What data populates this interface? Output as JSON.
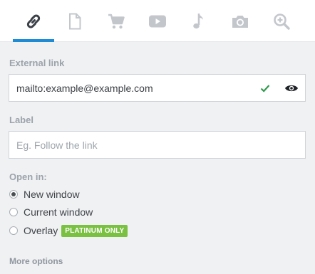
{
  "tabs": [
    {
      "icon": "link-icon",
      "active": true
    },
    {
      "icon": "document-icon",
      "active": false
    },
    {
      "icon": "cart-icon",
      "active": false
    },
    {
      "icon": "youtube-icon",
      "active": false
    },
    {
      "icon": "music-note-icon",
      "active": false
    },
    {
      "icon": "camera-icon",
      "active": false
    },
    {
      "icon": "zoom-in-icon",
      "active": false
    }
  ],
  "external_link": {
    "label": "External link",
    "value": "mailto:example@example.com",
    "valid": true
  },
  "label_field": {
    "label": "Label",
    "placeholder": "Eg. Follow the link",
    "value": ""
  },
  "open_in": {
    "label": "Open in:",
    "selected": "new_window",
    "options": [
      {
        "id": "new_window",
        "label": "New window"
      },
      {
        "id": "current_window",
        "label": "Current window"
      },
      {
        "id": "overlay",
        "label": "Overlay",
        "badge": "PLATINUM ONLY"
      }
    ]
  },
  "more_options": "More options",
  "colors": {
    "accent": "#1e8bd6",
    "icon_inactive": "#c3c7cc",
    "icon_active": "#3c4148",
    "valid_check": "#2f9a4e",
    "badge": "#7ac142",
    "background": "#f0f1f3"
  }
}
